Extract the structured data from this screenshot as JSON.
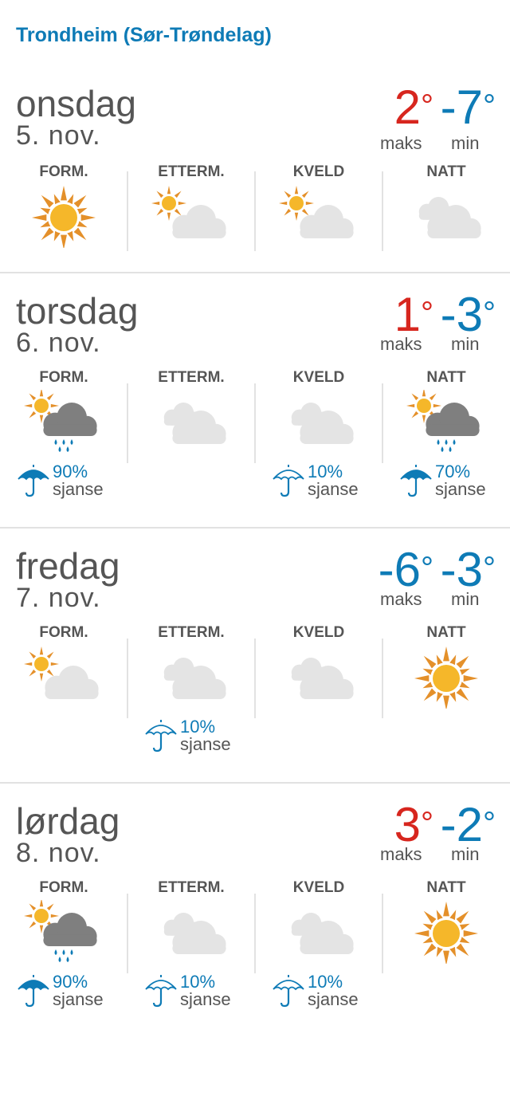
{
  "location": "Trondheim (Sør-Trøndelag)",
  "labels": {
    "max": "maks",
    "min": "min"
  },
  "days": [
    {
      "name": "onsdag",
      "date": "5. nov.",
      "max": "2",
      "min": "-7",
      "max_color": "#d7261e",
      "min_color": "#0e7bb6",
      "periods": [
        {
          "title": "FORM.",
          "icon": "sun-icon"
        },
        {
          "title": "ETTERM.",
          "icon": "partly-cloudy-icon"
        },
        {
          "title": "KVELD",
          "icon": "partly-cloudy-icon"
        },
        {
          "title": "NATT",
          "icon": "cloudy-icon"
        }
      ]
    },
    {
      "name": "torsdag",
      "date": "6. nov.",
      "max": "1",
      "min": "-3",
      "max_color": "#d7261e",
      "min_color": "#0e7bb6",
      "periods": [
        {
          "title": "FORM.",
          "icon": "sun-rain-cloud-icon",
          "precip": "90%",
          "precip_word": "sjanse",
          "umbrella": "filled"
        },
        {
          "title": "ETTERM.",
          "icon": "cloudy-icon"
        },
        {
          "title": "KVELD",
          "icon": "cloudy-icon",
          "precip": "10%",
          "precip_word": "sjanse",
          "umbrella": "outline"
        },
        {
          "title": "NATT",
          "icon": "sun-rain-cloud-icon",
          "precip": "70%",
          "precip_word": "sjanse",
          "umbrella": "filled"
        }
      ]
    },
    {
      "name": "fredag",
      "date": "7. nov.",
      "max": "-6",
      "min": "-3",
      "max_color": "#0e7bb6",
      "min_color": "#0e7bb6",
      "periods": [
        {
          "title": "FORM.",
          "icon": "partly-cloudy-icon"
        },
        {
          "title": "ETTERM.",
          "icon": "cloudy-icon",
          "precip": "10%",
          "precip_word": "sjanse",
          "umbrella": "outline"
        },
        {
          "title": "KVELD",
          "icon": "cloudy-icon"
        },
        {
          "title": "NATT",
          "icon": "sun-icon"
        }
      ]
    },
    {
      "name": "lørdag",
      "date": "8. nov.",
      "max": "3",
      "min": "-2",
      "max_color": "#d7261e",
      "min_color": "#0e7bb6",
      "periods": [
        {
          "title": "FORM.",
          "icon": "sun-rain-cloud-icon",
          "precip": "90%",
          "precip_word": "sjanse",
          "umbrella": "filled"
        },
        {
          "title": "ETTERM.",
          "icon": "cloudy-icon",
          "precip": "10%",
          "precip_word": "sjanse",
          "umbrella": "outline"
        },
        {
          "title": "KVELD",
          "icon": "cloudy-icon",
          "precip": "10%",
          "precip_word": "sjanse",
          "umbrella": "outline"
        },
        {
          "title": "NATT",
          "icon": "sun-icon"
        }
      ]
    }
  ]
}
